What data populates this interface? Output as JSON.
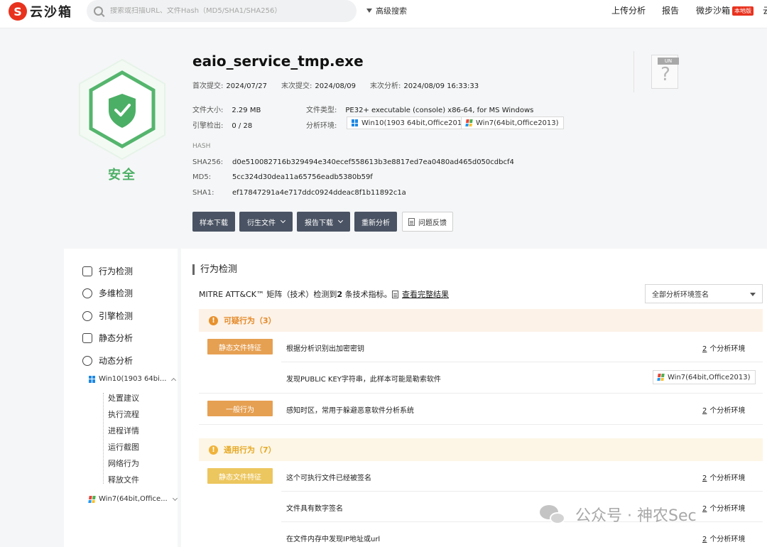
{
  "header": {
    "logo_mark": "S",
    "logo_text": "云沙箱",
    "search_placeholder": "搜索或扫描URL、文件Hash（MD5/SHA1/SHA256）",
    "advanced_search": "高级搜索",
    "nav": [
      "上传分析",
      "报告",
      "微步沙箱"
    ],
    "badge": "本地版",
    "nav_cut": "云"
  },
  "verdict": {
    "label": "安全",
    "color": "#4caf66"
  },
  "file": {
    "name": "eaio_service_tmp.exe",
    "first_submit_label": "首次提交:",
    "first_submit": "2024/07/27",
    "last_submit_label": "末次提交:",
    "last_submit": "2024/08/09",
    "last_analysis_label": "末次分析:",
    "last_analysis": "2024/08/09 16:33:33",
    "size_label": "文件大小:",
    "size": "2.29 MB",
    "type_label": "文件类型:",
    "type": "PE32+ executable (console) x86-64, for MS Windows",
    "engine_label": "引擎检出:",
    "engine": "0 / 28",
    "env_label": "分析环境:",
    "envs": [
      "Win10(1903 64bit,Office2016)",
      "Win7(64bit,Office2013)"
    ],
    "hash_heading": "HASH",
    "sha256_label": "SHA256:",
    "sha256": "d0e510082716b329494e340ecef558613b3e8817ed7ea0480ad465d050cdbcf4",
    "md5_label": "MD5:",
    "md5": "5cc324d30dea11a65756eadb5380b59f",
    "sha1_label": "SHA1:",
    "sha1": "ef17847291a4e717ddc0924ddeac8f1b11892c1a",
    "unknown_badge": "UN",
    "unknown_glyph": "?"
  },
  "actions": [
    "样本下载",
    "衍生文件",
    "报告下载",
    "重新分析",
    "问题反馈"
  ],
  "sidebar": {
    "items": [
      "行为检测",
      "多维检测",
      "引擎检测",
      "静态分析",
      "动态分析"
    ],
    "env1": "Win10(1903 64bi...",
    "sub_items": [
      "处置建议",
      "执行流程",
      "进程详情",
      "运行截图",
      "网络行为",
      "释放文件"
    ],
    "env2": "Win7(64bit,Office..."
  },
  "main": {
    "title": "行为检测",
    "mitre_prefix": "MITRE ATT&CK™ 矩阵（技术）检测到",
    "mitre_count": "2",
    "mitre_suffix": " 条技术指标。",
    "view_full": "查看完整结果",
    "select_value": "全部分析环境签名",
    "groups": [
      {
        "title": "可疑行为（3）"
      },
      {
        "title": "通用行为（7）"
      }
    ],
    "rows": [
      {
        "tag": "静态文件特征",
        "text": "根据分析识别出加密密钥",
        "count": "2",
        "env_suffix": "个分析环境"
      },
      {
        "tag": "",
        "text": "发现PUBLIC KEY字符串，此样本可能是勒索软件",
        "env_tag": "Win7(64bit,Office2013)"
      },
      {
        "tag": "一般行为",
        "text": "感知时区，常用于躲避恶意软件分析系统",
        "count": "2",
        "env_suffix": "个分析环境"
      },
      {
        "tag": "静态文件特征",
        "text": "这个可执行文件已经被签名",
        "count": "2",
        "env_suffix": "个分析环境"
      },
      {
        "tag": "",
        "text": "文件具有数字签名",
        "count": "2",
        "env_suffix": "个分析环境"
      },
      {
        "tag": "",
        "text": "在文件内存中发现IP地址或url",
        "count": "2",
        "env_suffix": "个分析环境"
      }
    ]
  },
  "watermark": "公众号 · 神农Sec"
}
